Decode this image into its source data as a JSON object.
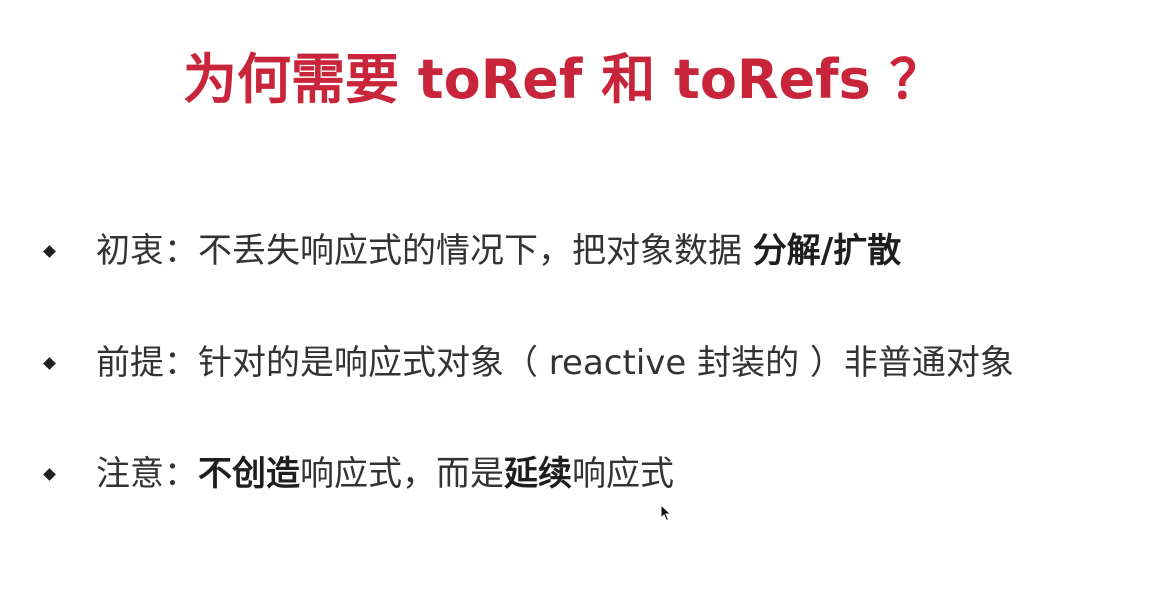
{
  "slide": {
    "title": "为何需要 toRef 和 toRefs ？",
    "bullets": [
      {
        "label": "初衷：",
        "text": "不丢失响应式的情况下，把对象数据 ",
        "bold": "分解/扩散"
      },
      {
        "label": "前提：",
        "text": "针对的是响应式对象（ reactive 封装的 ）非普通对象"
      },
      {
        "label": "注意：",
        "bold1": "不创造",
        "text1": "响应式，而是",
        "bold2": "延续",
        "text2": "响应式"
      }
    ]
  },
  "colors": {
    "title": "#c8243a",
    "text": "#333333",
    "background": "#ffffff"
  },
  "icons": {
    "bullet": "diamond-bullet-icon",
    "cursor": "mouse-pointer-icon"
  }
}
